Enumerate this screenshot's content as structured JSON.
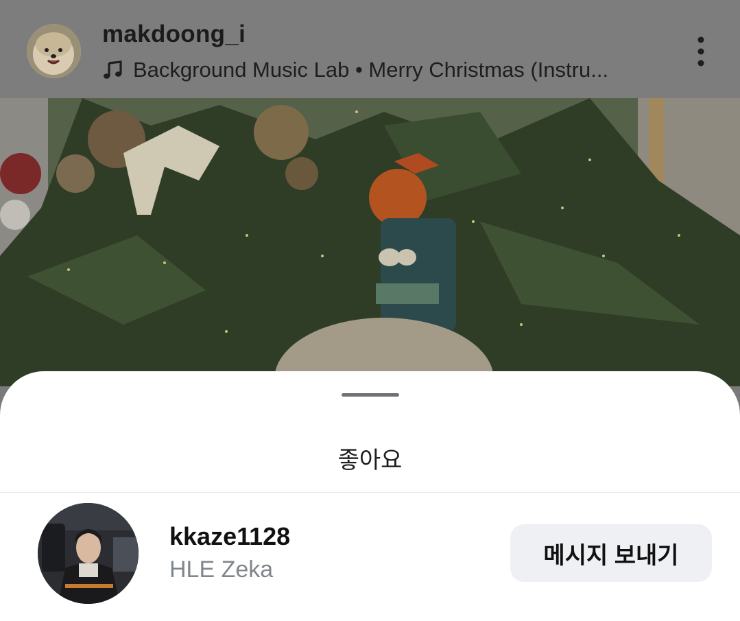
{
  "post_header": {
    "username": "makdoong_i",
    "music_text": "Background Music Lab • Merry Christmas (Instru...",
    "icons": {
      "music": "music-note-icon",
      "more": "more-vertical-icon"
    }
  },
  "likes_sheet": {
    "title": "좋아요",
    "users": [
      {
        "username": "kkaze1128",
        "full_name": "HLE Zeka",
        "button_label": "메시지 보내기"
      }
    ]
  },
  "colors": {
    "dim_overlay": "#7d7d7d",
    "sheet_bg": "#ffffff",
    "button_bg": "#eff0f4",
    "secondary_text": "#80868b"
  }
}
